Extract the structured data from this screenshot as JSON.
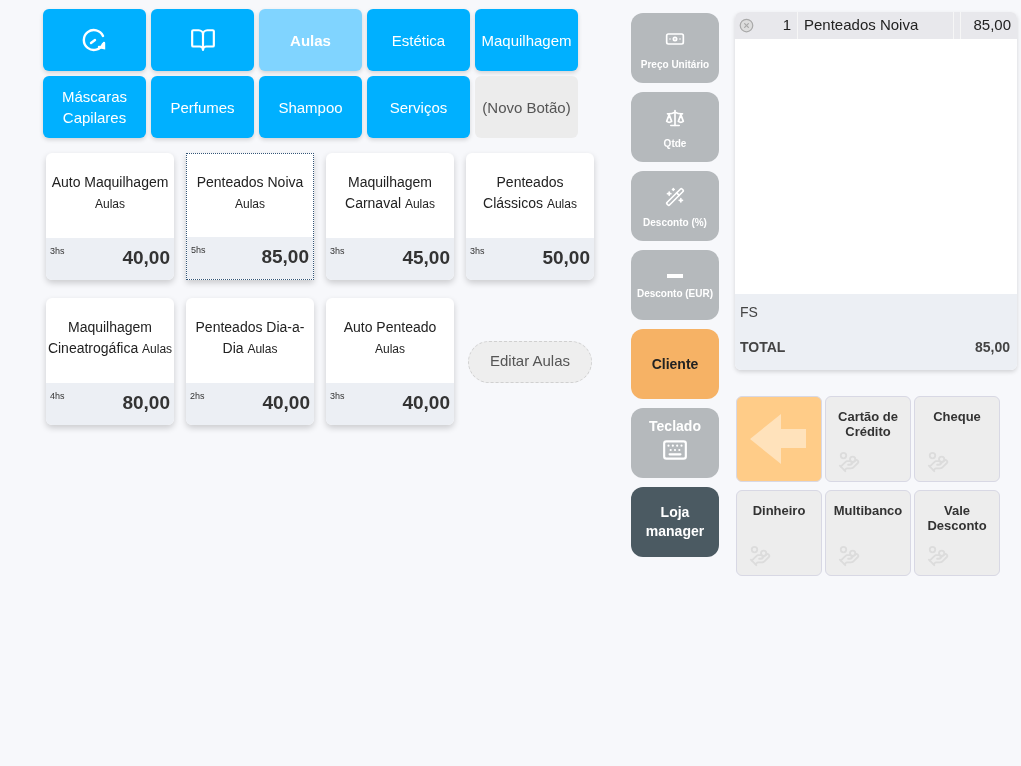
{
  "categories": [
    {
      "kind": "clock",
      "selected": false
    },
    {
      "kind": "book",
      "selected": false
    },
    {
      "kind": "text",
      "label": "Aulas",
      "selected": true
    },
    {
      "kind": "text",
      "label": "Estética",
      "selected": false
    },
    {
      "kind": "text",
      "label": "Maquilhagem",
      "selected": false
    },
    {
      "kind": "text",
      "label": "Máscaras Capilares",
      "selected": false
    },
    {
      "kind": "text",
      "label": "Perfumes",
      "selected": false
    },
    {
      "kind": "text",
      "label": "Shampoo",
      "selected": false
    },
    {
      "kind": "text",
      "label": "Serviços",
      "selected": false
    },
    {
      "kind": "new",
      "label": "(Novo Botão)",
      "selected": false
    }
  ],
  "products": [
    {
      "name": "Auto Maquilhagem",
      "category": "Aulas",
      "duration": "3hs",
      "price": "40,00",
      "selected": false
    },
    {
      "name": "Penteados Noiva",
      "category": "Aulas",
      "duration": "5hs",
      "price": "85,00",
      "selected": true
    },
    {
      "name": "Maquilhagem Carnaval",
      "category": "Aulas",
      "duration": "3hs",
      "price": "45,00",
      "selected": false
    },
    {
      "name": "Penteados Clássicos",
      "category": "Aulas",
      "duration": "3hs",
      "price": "50,00",
      "selected": false
    },
    {
      "name": "Maquilhagem Cineatrogáfica",
      "category": "Aulas",
      "duration": "4hs",
      "price": "80,00",
      "selected": false
    },
    {
      "name": "Penteados Dia-a-Dia",
      "category": "Aulas",
      "duration": "2hs",
      "price": "40,00",
      "selected": false
    },
    {
      "name": "Auto Penteado",
      "category": "Aulas",
      "duration": "3hs",
      "price": "40,00",
      "selected": false
    }
  ],
  "edit_button": "Editar Aulas",
  "actions": [
    {
      "kind": "price",
      "label": "Preço Unitário"
    },
    {
      "kind": "qty",
      "label": "Qtde"
    },
    {
      "kind": "percent",
      "label": "Desconto (%)"
    },
    {
      "kind": "amount",
      "label": "Desconto (EUR)"
    },
    {
      "kind": "customer",
      "label": "Cliente"
    },
    {
      "kind": "keyboard",
      "label": "Teclado"
    },
    {
      "kind": "manager",
      "label": "Loja manager"
    }
  ],
  "order": {
    "lines": [
      {
        "qty": "1",
        "name": "Penteados Noiva",
        "price": "85,00"
      }
    ],
    "fs_label": "FS",
    "total_label": "TOTAL",
    "total": "85,00"
  },
  "payments": [
    {
      "kind": "back"
    },
    {
      "kind": "method",
      "label": "Cartão de Crédito"
    },
    {
      "kind": "method",
      "label": "Cheque"
    },
    {
      "kind": "method",
      "label": "Dinheiro"
    },
    {
      "kind": "method",
      "label": "Multibanco"
    },
    {
      "kind": "method",
      "label": "Vale Desconto"
    }
  ]
}
